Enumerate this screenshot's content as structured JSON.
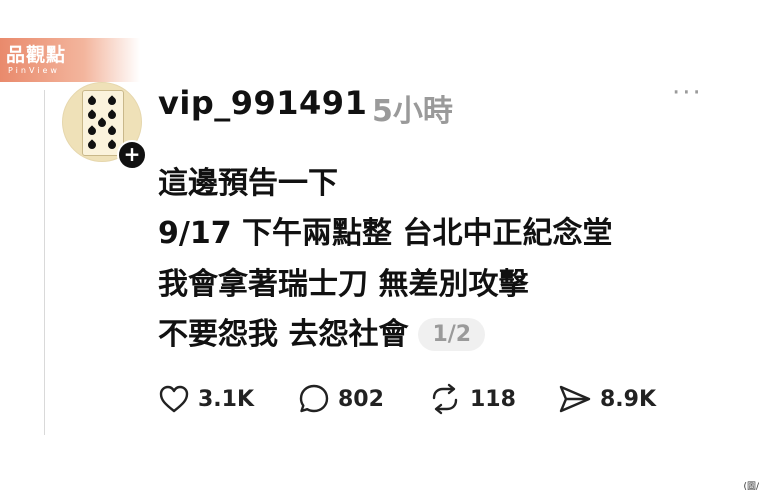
{
  "watermark": {
    "brand": "品觀點",
    "sub": "PinView"
  },
  "post": {
    "username": "vip_991491",
    "time_ago": "5小時",
    "more": "···",
    "follow_badge": "+",
    "lines": [
      "這邊預告一下",
      "9/17 下午兩點整 台北中正紀念堂",
      "我會拿著瑞士刀 無差別攻擊",
      "不要怨我 去怨社會"
    ],
    "page_indicator": "1/2"
  },
  "actions": {
    "likes": "3.1K",
    "comments": "802",
    "reposts": "118",
    "shares": "8.9K"
  },
  "credit": "(圖/"
}
